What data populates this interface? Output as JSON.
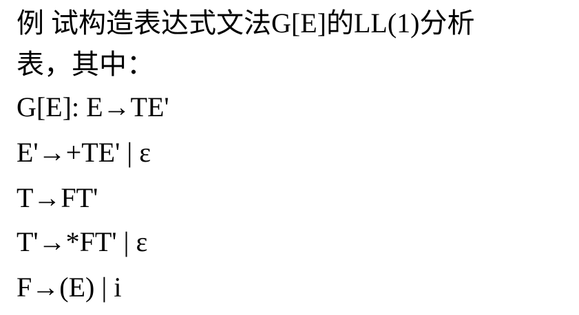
{
  "document": {
    "lines": [
      "例  试构造表达式文法G[E]的LL(1)分析",
      "表，其中：",
      "G[E]: E→TE'",
      "E'→+TE' | ε",
      "T→FT'",
      "T'→*FT' | ε",
      "F→(E) | i"
    ]
  }
}
